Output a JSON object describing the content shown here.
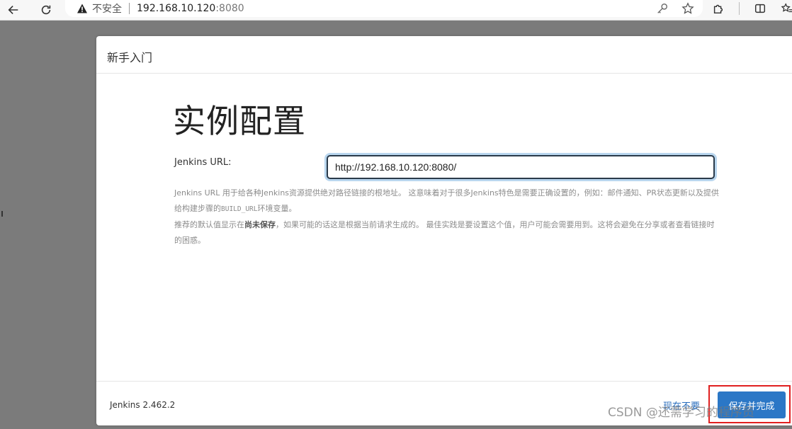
{
  "browser": {
    "insecure_label": "不安全",
    "url_host": "192.168.10.120",
    "url_port": ":8080"
  },
  "dialog": {
    "header_title": "新手入门",
    "page_title": "实例配置",
    "url_label": "Jenkins URL:",
    "url_value": "http://192.168.10.120:8080/",
    "help": {
      "p1_a": "Jenkins URL 用于给各种Jenkins资源提供绝对路径链接的根地址。 这意味着对于很多Jenkins特色是需要正确设置的，例如：邮件通知、PR状态更新以及提供给构建步骤的",
      "p1_code": "BUILD_URL",
      "p1_b": "环境变量。",
      "p2_a": "推荐的默认值显示在",
      "p2_bold": "尚未保存",
      "p2_b": "，如果可能的话这是根据当前请求生成的。 最佳实践是要设置这个值，用户可能会需要用到。这将会避免在分享或者查看链接时的困惑。"
    },
    "footer": {
      "version": "Jenkins 2.462.2",
      "skip_label": "现在不要",
      "save_label": "保存并完成"
    }
  },
  "watermark": "CSDN @还需学习的程序员",
  "icons": {
    "back": "arrow-left-icon",
    "reload": "reload-icon",
    "warning": "warning-triangle-icon",
    "key": "key-icon",
    "star": "star-icon",
    "extensions": "puzzle-icon",
    "split": "split-screen-icon",
    "favorites": "favorites-icon"
  }
}
